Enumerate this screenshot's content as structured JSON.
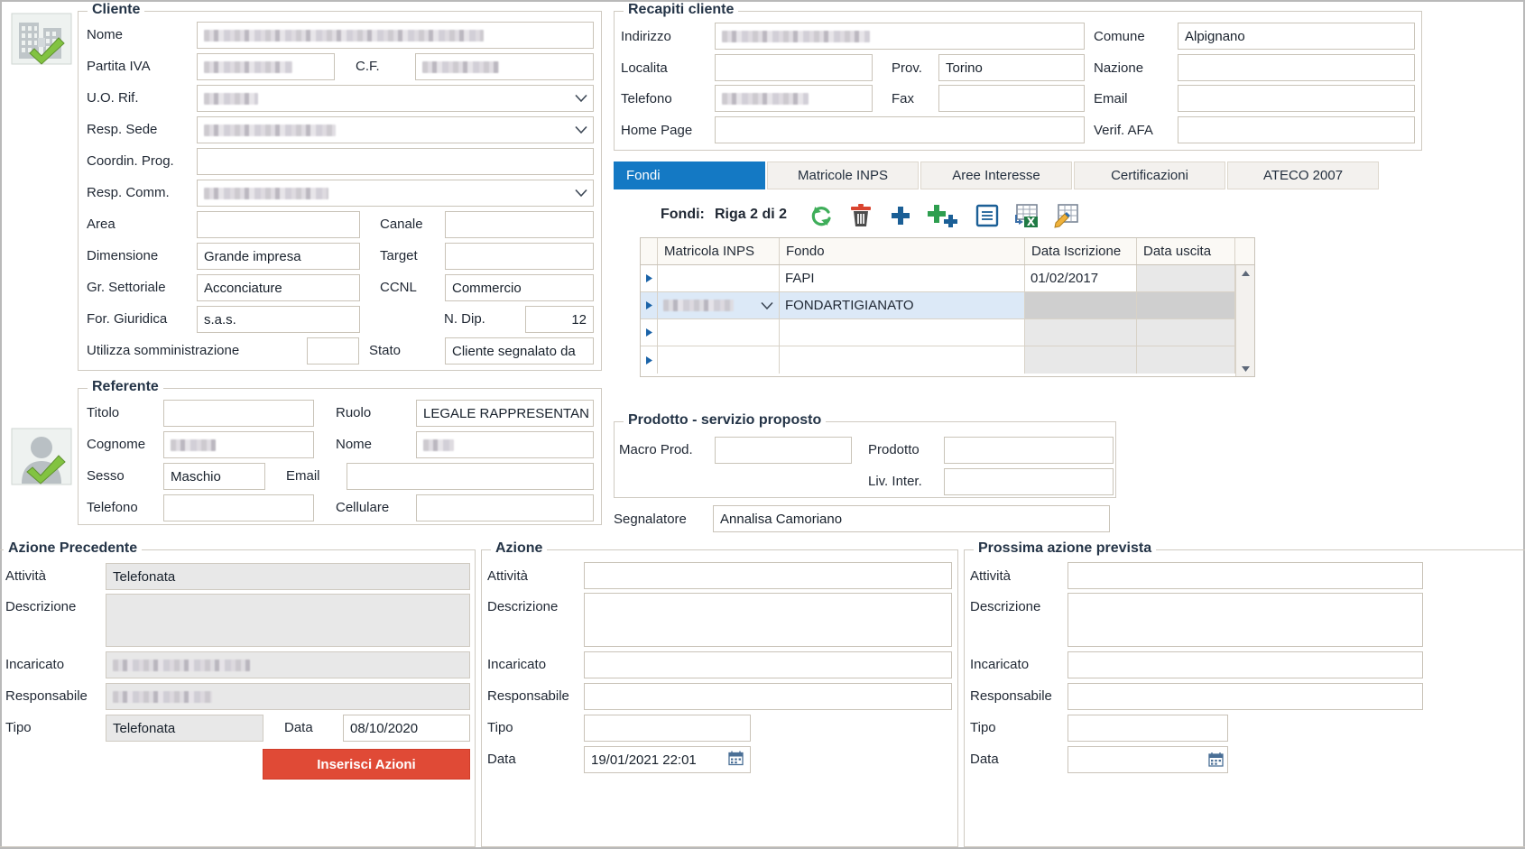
{
  "cliente": {
    "title": "Cliente",
    "icon": "company-verified-icon",
    "labels": {
      "nome": "Nome",
      "partita_iva": "Partita IVA",
      "cf": "C.F.",
      "uo_rif": "U.O. Rif.",
      "resp_sede": "Resp. Sede",
      "coordin_prog": "Coordin. Prog.",
      "resp_comm": "Resp. Comm.",
      "area": "Area",
      "canale": "Canale",
      "dimensione": "Dimensione",
      "target": "Target",
      "gr_settoriale": "Gr. Settoriale",
      "ccnl": "CCNL",
      "for_giuridica": "For. Giuridica",
      "n_dip": "N. Dip.",
      "utilizza_somministrazione": "Utilizza somministrazione",
      "stato": "Stato"
    },
    "values": {
      "nome": "",
      "partita_iva": "",
      "cf": "",
      "uo_rif": "",
      "resp_sede": "",
      "coordin_prog": "",
      "resp_comm": "",
      "area": "",
      "canale": "",
      "dimensione": "Grande impresa",
      "target": "",
      "gr_settoriale": "Acconciature",
      "ccnl": "Commercio",
      "for_giuridica": "s.a.s.",
      "n_dip": "12",
      "utilizza_somministrazione": "",
      "stato": "Cliente segnalato da"
    }
  },
  "recapiti": {
    "title": "Recapiti cliente",
    "labels": {
      "indirizzo": "Indirizzo",
      "comune": "Comune",
      "localita": "Localita",
      "prov": "Prov.",
      "nazione": "Nazione",
      "telefono": "Telefono",
      "fax": "Fax",
      "email": "Email",
      "home_page": "Home Page",
      "verif_afa": "Verif. AFA"
    },
    "values": {
      "indirizzo": "",
      "comune": "Alpignano",
      "localita": "",
      "prov": "Torino",
      "nazione": "",
      "telefono": "",
      "fax": "",
      "email": "",
      "home_page": "",
      "verif_afa": ""
    }
  },
  "tabs": [
    {
      "label": "Fondi",
      "active": true
    },
    {
      "label": "Matricole INPS",
      "active": false
    },
    {
      "label": "Aree Interesse",
      "active": false
    },
    {
      "label": "Certificazioni",
      "active": false
    },
    {
      "label": "ATECO 2007",
      "active": false
    }
  ],
  "fondi_panel": {
    "caption": "Fondi:",
    "row_status": "Riga 2 di 2",
    "toolbar": [
      {
        "name": "refresh-icon",
        "title": "Aggiorna"
      },
      {
        "name": "delete-icon",
        "title": "Elimina"
      },
      {
        "name": "add-icon",
        "title": "Aggiungi"
      },
      {
        "name": "add-multiple-icon",
        "title": "Aggiungi multiplo"
      },
      {
        "name": "save-icon",
        "title": "Salva"
      },
      {
        "name": "export-excel-icon",
        "title": "Esporta in Excel"
      },
      {
        "name": "edit-grid-icon",
        "title": "Modifica griglia"
      }
    ],
    "columns": [
      "Matricola INPS",
      "Fondo",
      "Data Iscrizione",
      "Data uscita"
    ],
    "rows": [
      {
        "matricola": "",
        "matricola_redacted": false,
        "fondo": "FAPI",
        "data_iscrizione": "01/02/2017",
        "data_uscita": "",
        "selected": false
      },
      {
        "matricola": "",
        "matricola_redacted": true,
        "fondo": "FONDARTIGIANATO",
        "data_iscrizione": "",
        "data_uscita": "",
        "selected": true
      },
      {
        "matricola": "",
        "matricola_redacted": false,
        "fondo": "",
        "data_iscrizione": "",
        "data_uscita": "",
        "selected": false
      },
      {
        "matricola": "",
        "matricola_redacted": false,
        "fondo": "",
        "data_iscrizione": "",
        "data_uscita": "",
        "selected": false
      }
    ]
  },
  "referente": {
    "title": "Referente",
    "icon": "person-verified-icon",
    "labels": {
      "titolo": "Titolo",
      "ruolo": "Ruolo",
      "cognome": "Cognome",
      "nome": "Nome",
      "sesso": "Sesso",
      "email": "Email",
      "telefono": "Telefono",
      "cellulare": "Cellulare"
    },
    "values": {
      "titolo": "",
      "ruolo": "LEGALE RAPPRESENTAN",
      "cognome": "",
      "nome": "",
      "sesso": "Maschio",
      "email": "",
      "telefono": "",
      "cellulare": ""
    }
  },
  "prodotto": {
    "title": "Prodotto - servizio proposto",
    "labels": {
      "macro_prod": "Macro Prod.",
      "prodotto": "Prodotto",
      "liv_inter": "Liv. Inter."
    },
    "values": {
      "macro_prod": "",
      "prodotto": "",
      "liv_inter": ""
    }
  },
  "segnalatore": {
    "label": "Segnalatore",
    "value": "Annalisa Camoriano"
  },
  "azione_precedente": {
    "title": "Azione Precedente",
    "labels": {
      "attivita": "Attività",
      "descrizione": "Descrizione",
      "incaricato": "Incaricato",
      "responsabile": "Responsabile",
      "tipo": "Tipo",
      "data": "Data"
    },
    "values": {
      "attivita": "Telefonata",
      "descrizione": "",
      "incaricato": "",
      "responsabile": "",
      "tipo": "Telefonata",
      "data": "08/10/2020"
    },
    "button": "Inserisci Azioni"
  },
  "azione": {
    "title": "Azione",
    "labels": {
      "attivita": "Attività",
      "descrizione": "Descrizione",
      "incaricato": "Incaricato",
      "responsabile": "Responsabile",
      "tipo": "Tipo",
      "data": "Data"
    },
    "values": {
      "attivita": "",
      "descrizione": "",
      "incaricato": "",
      "responsabile": "",
      "tipo": "",
      "data": "19/01/2021 22:01"
    }
  },
  "prossima_azione": {
    "title": "Prossima azione prevista",
    "labels": {
      "attivita": "Attività",
      "descrizione": "Descrizione",
      "incaricato": "Incaricato",
      "responsabile": "Responsabile",
      "tipo": "Tipo",
      "data": "Data"
    },
    "values": {
      "attivita": "",
      "descrizione": "",
      "incaricato": "",
      "responsabile": "",
      "tipo": "",
      "data": ""
    }
  },
  "colors": {
    "tab_active_bg": "#1479c4",
    "button_primary_bg": "#e04a36",
    "grid_selected_bg": "#dce9f7",
    "readonly_bg": "#e8e8e8",
    "border": "#cfcac1",
    "label_text": "#1f2733"
  }
}
